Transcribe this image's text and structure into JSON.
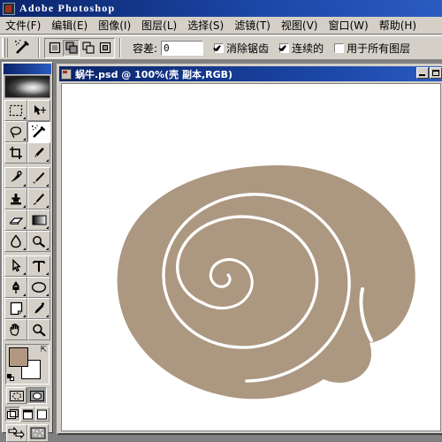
{
  "app": {
    "title": "Adobe Photoshop",
    "icon": "photoshop-app-icon"
  },
  "menubar": {
    "items": [
      {
        "label": "文件(F)"
      },
      {
        "label": "编辑(E)"
      },
      {
        "label": "图像(I)"
      },
      {
        "label": "图层(L)"
      },
      {
        "label": "选择(S)"
      },
      {
        "label": "滤镜(T)"
      },
      {
        "label": "视图(V)"
      },
      {
        "label": "窗口(W)"
      },
      {
        "label": "帮助(H)"
      }
    ]
  },
  "options_bar": {
    "active_tool_icon": "magic-wand-icon",
    "selection_modes": [
      {
        "name": "new-selection",
        "active": false
      },
      {
        "name": "add-to-selection",
        "active": true
      },
      {
        "name": "subtract-from-selection",
        "active": false
      },
      {
        "name": "intersect-with-selection",
        "active": false
      }
    ],
    "tolerance_label": "容差:",
    "tolerance_value": "0",
    "anti_alias_label": "消除锯齿",
    "anti_alias_checked": true,
    "contiguous_label": "连续的",
    "contiguous_checked": true,
    "all_layers_label": "用于所有图层",
    "all_layers_checked": false
  },
  "toolbox": {
    "rows": [
      [
        {
          "name": "rectangular-marquee-icon",
          "selected": false,
          "glyph": "▢"
        },
        {
          "name": "move-icon",
          "selected": false,
          "glyph": "✥"
        }
      ],
      [
        {
          "name": "lasso-icon",
          "selected": false,
          "glyph": "◯"
        },
        {
          "name": "magic-wand-icon",
          "selected": true,
          "glyph": "✦"
        }
      ],
      [
        {
          "name": "crop-icon",
          "selected": false,
          "glyph": "⌗"
        },
        {
          "name": "slice-icon",
          "selected": false,
          "glyph": "✂"
        }
      ],
      [
        {
          "name": "healing-brush-icon",
          "selected": false,
          "glyph": "✒"
        },
        {
          "name": "paintbrush-icon",
          "selected": false,
          "glyph": "🖌"
        }
      ],
      [
        {
          "name": "clone-stamp-icon",
          "selected": false,
          "glyph": "❖"
        },
        {
          "name": "history-brush-icon",
          "selected": false,
          "glyph": "✏"
        }
      ],
      [
        {
          "name": "eraser-icon",
          "selected": false,
          "glyph": "▭"
        },
        {
          "name": "gradient-icon",
          "selected": false,
          "glyph": "▤"
        }
      ],
      [
        {
          "name": "blur-icon",
          "selected": false,
          "glyph": "💧"
        },
        {
          "name": "dodge-icon",
          "selected": false,
          "glyph": "✋"
        }
      ],
      [
        {
          "name": "path-selection-icon",
          "selected": false,
          "glyph": "➤"
        },
        {
          "name": "type-icon",
          "selected": false,
          "glyph": "T"
        }
      ],
      [
        {
          "name": "pen-icon",
          "selected": false,
          "glyph": "✐"
        },
        {
          "name": "shape-icon",
          "selected": false,
          "glyph": "◯"
        }
      ],
      [
        {
          "name": "notes-icon",
          "selected": false,
          "glyph": "▤"
        },
        {
          "name": "eyedropper-icon",
          "selected": false,
          "glyph": "⌖"
        }
      ],
      [
        {
          "name": "hand-icon",
          "selected": false,
          "glyph": "✋"
        },
        {
          "name": "zoom-icon",
          "selected": false,
          "glyph": "⌕"
        }
      ]
    ],
    "foreground_color": "#b39881",
    "background_color": "#ffffff",
    "quick_mask": [
      {
        "name": "standard-mode-button",
        "active": false
      },
      {
        "name": "quick-mask-mode-button",
        "active": true
      }
    ],
    "screen_modes": [
      {
        "name": "standard-screen-mode-button",
        "active": true
      },
      {
        "name": "full-screen-with-menubar-button",
        "active": false
      },
      {
        "name": "full-screen-mode-button",
        "active": false
      }
    ],
    "jump_to": [
      {
        "name": "jump-to-imageready-button"
      },
      {
        "name": "imageready-preview-button"
      }
    ]
  },
  "document": {
    "title": "蜗牛.psd @ 100%(壳 副本,RGB)",
    "zoom": "100%",
    "layer_name": "壳 副本",
    "color_mode": "RGB",
    "minimize_label": "minimize",
    "restore_label": "restore",
    "artwork": {
      "name": "snail-shell-spiral",
      "shell_color": "#ac9780",
      "background_color": "#ffffff",
      "spiral_line_color": "#ffffff"
    }
  }
}
